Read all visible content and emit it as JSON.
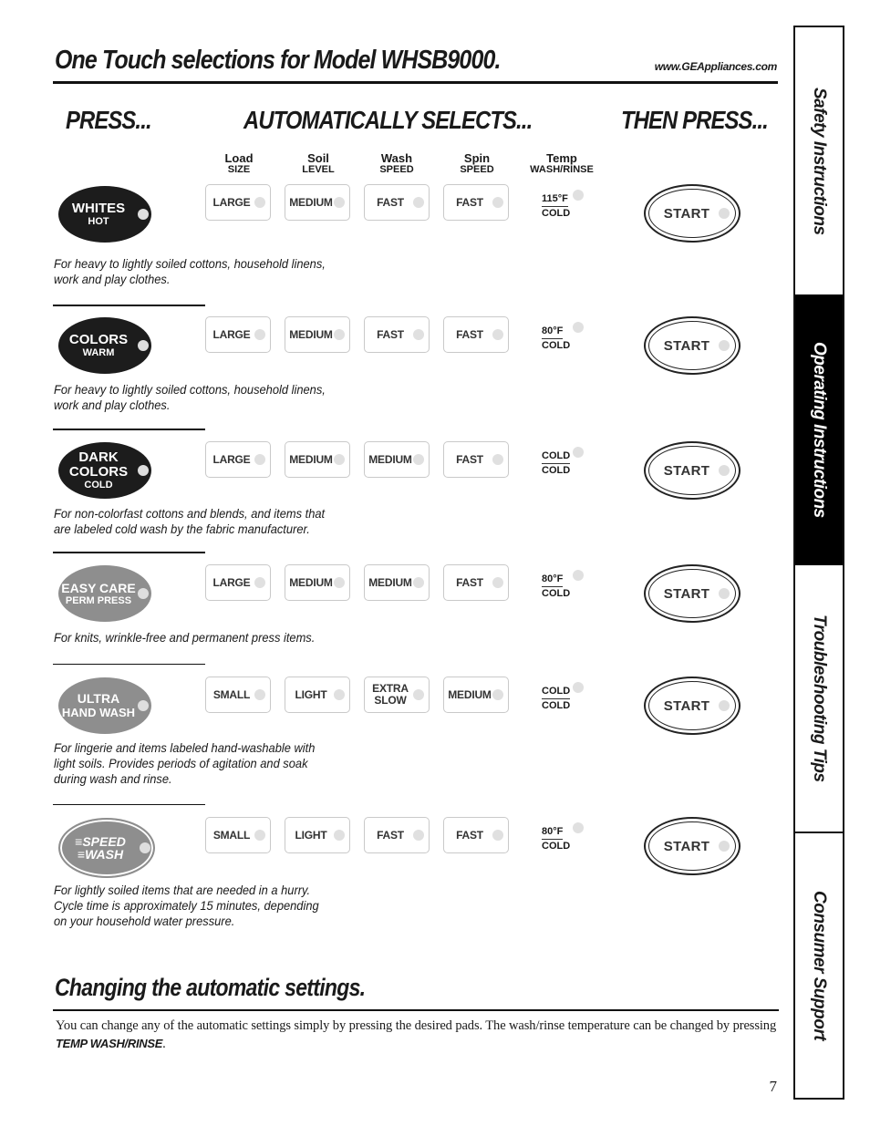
{
  "header": {
    "title_smallcaps_1": "One",
    "title_smallcaps_2": "Touch",
    "title_rest": "selections for Model WHSB9000.",
    "url": "www.GEAppliances.com"
  },
  "columns": {
    "press": "PRESS...",
    "auto_selects": "AUTOMATICALLY SELECTS...",
    "then_press": "THEN PRESS..."
  },
  "setting_headers": [
    {
      "line1": "Load",
      "line2": "SIZE"
    },
    {
      "line1": "Soil",
      "line2": "LEVEL"
    },
    {
      "line1": "Wash",
      "line2": "SPEED"
    },
    {
      "line1": "Spin",
      "line2": "SPEED"
    },
    {
      "line1": "Temp",
      "line2": "WASH/RINSE"
    }
  ],
  "cycles": [
    {
      "name_line1": "Whites",
      "name_line2": "HOT",
      "name_line3": "",
      "load": "Large",
      "soil": "Medium",
      "wash": "Fast",
      "spin": "Fast",
      "temp_wash": "115°F",
      "temp_rinse": "COLD",
      "start": "Start",
      "desc_line1": "For heavy to lightly soiled cottons, household linens,",
      "desc_line2": "work and play clothes.",
      "desc_line3": ""
    },
    {
      "name_line1": "Colors",
      "name_line2": "WARM",
      "name_line3": "",
      "load": "Large",
      "soil": "Medium",
      "wash": "Fast",
      "spin": "Fast",
      "temp_wash": "80°F",
      "temp_rinse": "COLD",
      "start": "Start",
      "desc_line1": "For heavy to lightly soiled cottons, household linens,",
      "desc_line2": "work and play clothes.",
      "desc_line3": ""
    },
    {
      "name_line1": "Dark",
      "name_line2": "Colors",
      "name_line3": "COLD",
      "load": "Large",
      "soil": "Medium",
      "wash": "Medium",
      "spin": "Fast",
      "temp_wash": "COLD",
      "temp_rinse": "COLD",
      "start": "Start",
      "desc_line1": "For non-colorfast cottons and blends, and items that",
      "desc_line2": "are labeled cold wash by the fabric manufacturer.",
      "desc_line3": ""
    },
    {
      "name_line1": "Easy Care",
      "name_line2": "PERM PRESS",
      "name_line3": "",
      "load": "Large",
      "soil": "Medium",
      "wash": "Medium",
      "spin": "Fast",
      "temp_wash": "80°F",
      "temp_rinse": "COLD",
      "start": "Start",
      "desc_line1": "For knits, wrinkle-free and permanent press items.",
      "desc_line2": "",
      "desc_line3": ""
    },
    {
      "name_line1": "Ultra",
      "name_line2": "Hand Wash",
      "name_line3": "",
      "load": "Small",
      "soil": "Light",
      "wash_line1": "Extra",
      "wash_line2": "Slow",
      "spin": "Medium",
      "temp_wash": "COLD",
      "temp_rinse": "COLD",
      "start": "Start",
      "desc_line1": "For lingerie and items labeled hand-washable with",
      "desc_line2": "light soils. Provides periods of agitation and soak",
      "desc_line3": "during wash and rinse."
    },
    {
      "name_line1": "SPEED",
      "name_line2": "WASH",
      "name_line3": "",
      "load": "Small",
      "soil": "Light",
      "wash": "Fast",
      "spin": "Fast",
      "temp_wash": "80°F",
      "temp_rinse": "COLD",
      "start": "Start",
      "desc_line1": "For lightly soiled items that are needed in a hurry.",
      "desc_line2": "Cycle time is approximately 15 minutes, depending",
      "desc_line3": "on your household water pressure."
    }
  ],
  "changing": {
    "title": "Changing the automatic settings.",
    "text_before": "You can change any of the automatic settings simply by pressing the desired pads. The wash/rinse temperature can be changed by pressing ",
    "text_bold": "TEMP WASH/RINSE",
    "text_after": "."
  },
  "page_number": "7",
  "side_tabs": [
    {
      "label": "Safety Instructions",
      "active": false
    },
    {
      "label": "Operating Instructions",
      "active": true
    },
    {
      "label": "Troubleshooting Tips",
      "active": false
    },
    {
      "label": "Consumer Support",
      "active": false
    }
  ],
  "colors": {
    "dark_button": "#1c1c1c",
    "gray_button": "#8e8e8e",
    "led": "#dedede",
    "active_tab": "#000000"
  }
}
